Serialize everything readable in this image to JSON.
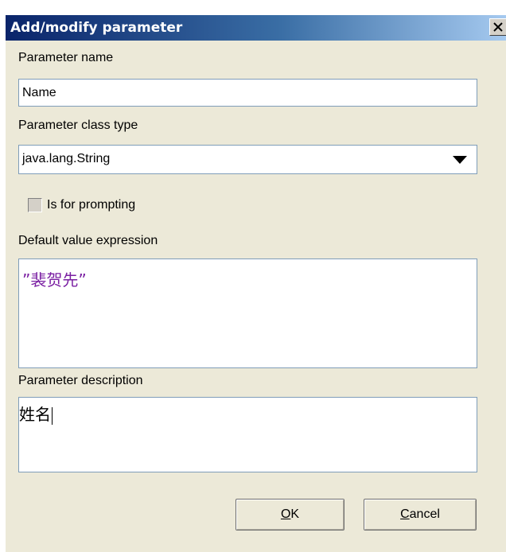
{
  "window": {
    "title": "Add/modify parameter"
  },
  "form": {
    "name_label": "Parameter name",
    "name_value": "Name",
    "class_label": "Parameter class type",
    "class_value": "java.lang.String",
    "prompt_label": "Is for prompting",
    "prompt_checked": false,
    "default_label": "Default value expression",
    "default_value": "”裴贺先”",
    "description_label": "Parameter description",
    "description_value": "姓名"
  },
  "buttons": {
    "ok_mnemonic": "O",
    "ok_rest": "K",
    "cancel_mnemonic": "C",
    "cancel_rest": "ancel"
  },
  "icons": {
    "close": "close-icon",
    "dropdown": "triangle-down-icon"
  },
  "colors": {
    "titlebar_start": "#0a246a",
    "titlebar_end": "#a6caf0",
    "dialog_bg": "#ece9d8",
    "expression_text": "#7a1fa2"
  }
}
